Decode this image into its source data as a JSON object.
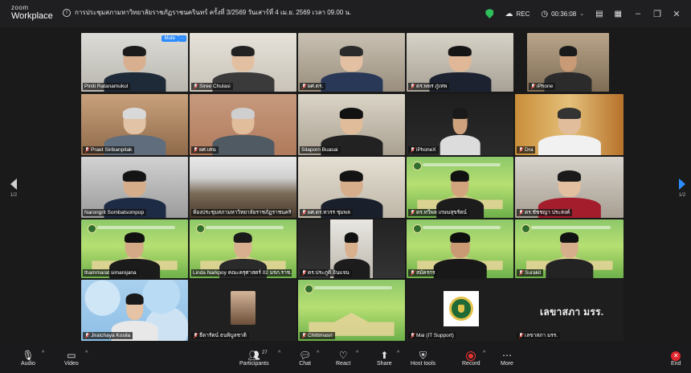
{
  "app": {
    "logo_top": "zoom",
    "logo_bottom": "Workplace"
  },
  "meeting": {
    "title": "การประชุมสภามหาวิทยาลัยราชภัฏราชนครินทร์ ครั้งที่ 3/2569 วันเสาร์ที่ 4 เม.ย. 2569 เวลา 09.00 น."
  },
  "status": {
    "rec_label": "REC",
    "timer": "00:36:08"
  },
  "colors": {
    "accent": "#2d8cff",
    "active_speaker": "#2fd35c",
    "record": "#e33333",
    "end": "#e0262d"
  },
  "pagination": {
    "left": "1/2",
    "right": "1/2"
  },
  "tile_controls": {
    "mute": "Mute",
    "more": "···"
  },
  "participants": [
    {
      "name": "Piniti Ratanamukul"
    },
    {
      "name": "Siree Chulasi"
    },
    {
      "name": "ผศ.ดร."
    },
    {
      "name": "ดร.พพร ภู่เทพ"
    },
    {
      "name": "iPhone"
    },
    {
      "name": "Praet Siribanpitak"
    },
    {
      "name": "ผศ.เคน"
    },
    {
      "name": "Silaporn Buasai"
    },
    {
      "name": "iPhoneX"
    },
    {
      "name": "Dra"
    },
    {
      "name": "Narongrit Sombatsompop"
    },
    {
      "name": "ห้องประชุมสภามหาวิทยาลัยราชภัฏราชนครินทร์"
    },
    {
      "name": "ผศ.ดร.ทวรร ชุมพล"
    },
    {
      "name": "ดร.ทวีพล เกษมสุขรัตน์"
    },
    {
      "name": "ดร.ชัชชญา ประสงค์"
    },
    {
      "name": "thammarat simarojana"
    },
    {
      "name": "Linda Narkpoy คณะครุศาสตร์ 02 มรภ.ราช..."
    },
    {
      "name": "ดร.ประภูติ อินแจน"
    },
    {
      "name": "สมัครกร"
    },
    {
      "name": "Surakit"
    },
    {
      "name": "Jiratchaya Kosila"
    },
    {
      "name": "ธีดารัตน์ ธนพิบูลชาติ"
    },
    {
      "name": "Chittimasri"
    },
    {
      "name": "Mai (IT Support)"
    },
    {
      "name": "เลขาสภา มรร."
    }
  ],
  "big_label": "เลขาสภา มรร.",
  "toolbar": {
    "audio": "Audio",
    "video": "Video",
    "participants": "Participants",
    "participants_count": "27",
    "chat": "Chat",
    "react": "React",
    "share": "Share",
    "host_tools": "Host tools",
    "record": "Record",
    "more": "More",
    "end": "End"
  }
}
